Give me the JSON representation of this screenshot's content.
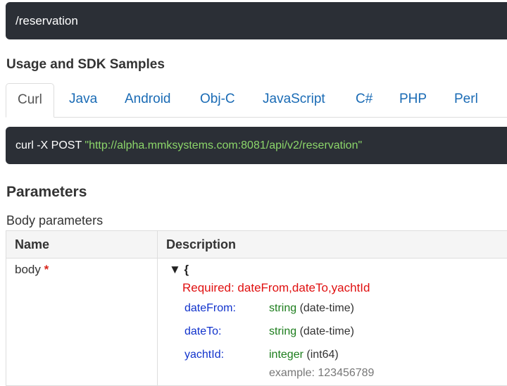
{
  "endpoint": {
    "path": "/reservation"
  },
  "usage": {
    "title": "Usage and SDK Samples",
    "tabs": [
      {
        "label": "Curl",
        "active": true
      },
      {
        "label": "Java"
      },
      {
        "label": "Android"
      },
      {
        "label": "Obj-C"
      },
      {
        "label": "JavaScript"
      },
      {
        "label": "C#"
      },
      {
        "label": "PHP"
      },
      {
        "label": "Perl"
      }
    ]
  },
  "curl": {
    "command": "curl -X POST",
    "url": "\"http://alpha.mmksystems.com:8081/api/v2/reservation\""
  },
  "parameters": {
    "title": "Parameters",
    "body_label": "Body parameters",
    "headers": {
      "name": "Name",
      "description": "Description"
    },
    "body": {
      "name": "body",
      "required_marker": "*",
      "schema_open": "▼ {",
      "required_text": "Required: dateFrom,dateTo,yachtId",
      "properties": [
        {
          "name": "dateFrom:",
          "type": "string",
          "format": "(date-time)"
        },
        {
          "name": "dateTo:",
          "type": "string",
          "format": "(date-time)"
        },
        {
          "name": "yachtId:",
          "type": "integer",
          "format": "(int64)",
          "example": "example: 123456789"
        }
      ]
    }
  },
  "colors": {
    "dark_bar": "#2b2f36",
    "link_blue": "#1a6bb5",
    "url_green": "#8cd66a",
    "required_red": "#e01010",
    "prop_blue": "#1133cc",
    "type_green": "#1c7d1c"
  }
}
